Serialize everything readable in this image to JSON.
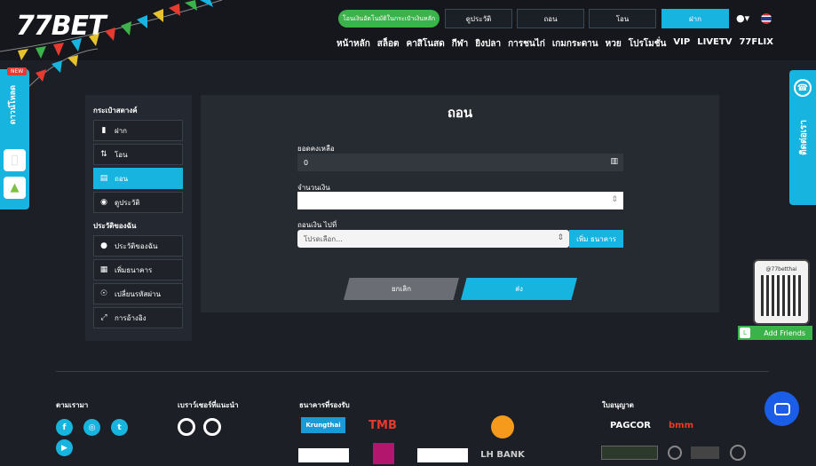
{
  "brand": {
    "logo": "77BET"
  },
  "header": {
    "auto_withdraw": "โอนเงินอัตโนมัติในกระเป๋าเงินหลัก",
    "buttons": [
      {
        "label": "ดูประวัติ",
        "active": false
      },
      {
        "label": "ถอน",
        "active": false
      },
      {
        "label": "โอน",
        "active": false
      },
      {
        "label": "ฝาก",
        "active": true
      }
    ],
    "nav": [
      "หน้าหลัก",
      "สล็อต",
      "คาสิโนสด",
      "กีฬา",
      "ยิงปลา",
      "การชนไก่",
      "เกมกระดาน",
      "หวย",
      "โปรโมชั่น",
      "VIP",
      "LIVETV",
      "77FLIX"
    ]
  },
  "left_tab": {
    "badge": "NEW",
    "label": "ดาวน์โหลด"
  },
  "right_tab": {
    "label": "ติดต่อเรา"
  },
  "line": {
    "handle": "@77betthai",
    "add_friends": "Add Friends"
  },
  "sidebar": {
    "wallet_heading": "กระเป๋าสตางค์",
    "wallet_items": [
      {
        "label": "ฝาก",
        "icon": "wallet-icon",
        "active": false
      },
      {
        "label": "โอน",
        "icon": "transfer-icon",
        "active": false
      },
      {
        "label": "ถอน",
        "icon": "withdraw-icon",
        "active": true
      },
      {
        "label": "ดูประวัติ",
        "icon": "history-icon",
        "active": false
      }
    ],
    "profile_heading": "ประวัติของฉัน",
    "profile_items": [
      {
        "label": "ประวัติของฉัน",
        "icon": "user-icon"
      },
      {
        "label": "เพิ่มธนาคาร",
        "icon": "bank-icon"
      },
      {
        "label": "เปลี่ยนรหัสผ่าน",
        "icon": "lock-icon"
      },
      {
        "label": "การอ้างอิง",
        "icon": "share-icon"
      }
    ]
  },
  "panel": {
    "title": "ถอน",
    "balance_label": "ยอดคงเหลือ",
    "balance_value": "0",
    "amount_label": "จำนวนเงิน",
    "amount_value": "",
    "withdraw_to_label": "ถอนเงิน ไปที่",
    "select_placeholder": "โปรดเลือก...",
    "add_bank_button": "เพิ่ม ธนาคาร",
    "cancel_button": "ยกเลิก",
    "submit_button": "ส่ง"
  },
  "footer": {
    "follow_heading": "ตามเรามา",
    "browser_heading": "เบราว์เซอร์ที่แนะนำ",
    "banks_heading": "ธนาคารที่รองรับ",
    "license_heading": "ใบอนุญาต",
    "banks": [
      "Krungthai",
      "TMB",
      "Krungthai",
      "",
      "",
      "",
      "",
      "LH BANK"
    ],
    "licenses": [
      "PAGCOR",
      "bmm"
    ]
  },
  "colors": {
    "accent": "#18b4e0",
    "green": "#3cb34a",
    "panel": "#262a31",
    "bg": "#1c1f26"
  }
}
